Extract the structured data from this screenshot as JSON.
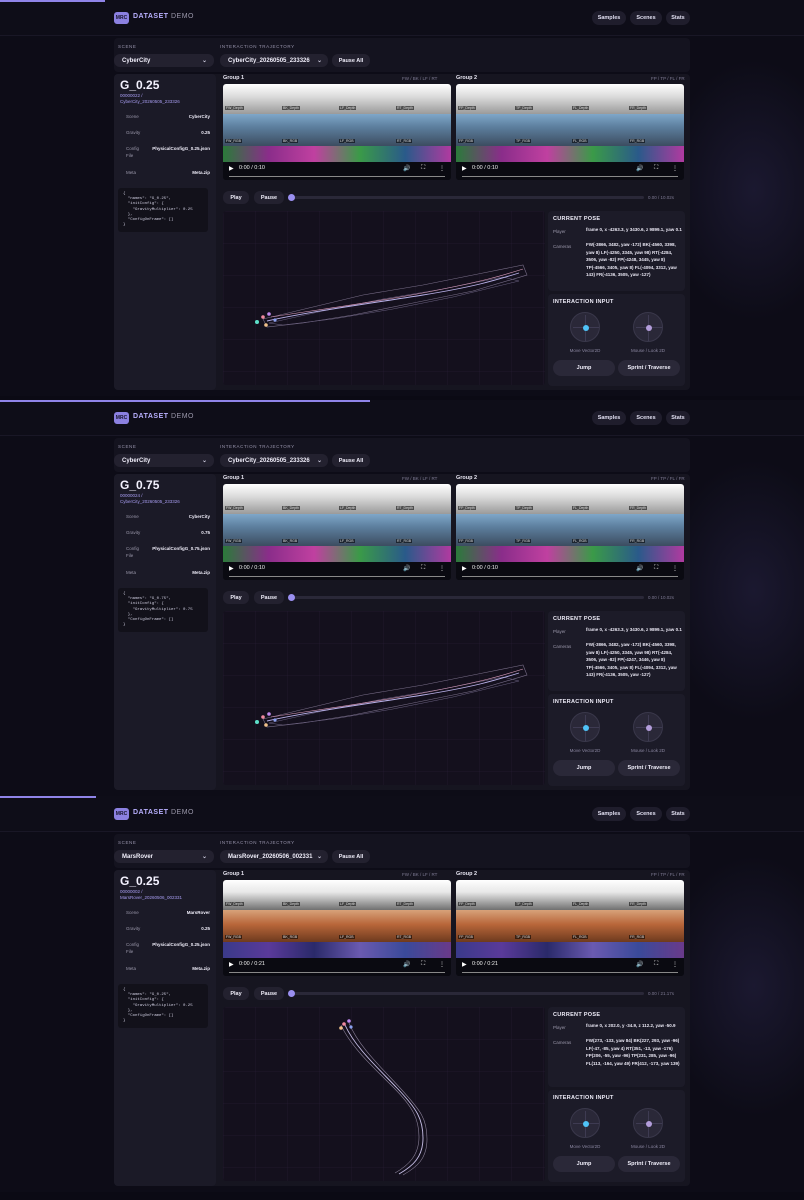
{
  "app": {
    "logo": "MRC",
    "brand_bold": "DATASET",
    "brand_light": "DEMO",
    "nav": [
      "Samples",
      "Scenes",
      "Stats"
    ]
  },
  "labels": {
    "scene": "SCENE",
    "trajectory": "INTERACTION TRAJECTORY",
    "pause_all": "Pause All",
    "play": "Play",
    "pause": "Pause",
    "group1": "Group 1",
    "group2": "Group 2",
    "group1_views": "FW / BK / LF / RT",
    "group2_views": "FP / TP / FL / FR",
    "current_pose": "CURRENT POSE",
    "player": "Player",
    "cameras": "Cameras",
    "interaction_input": "INTERACTION INPUT",
    "move": "Move Vector2D",
    "mouse": "Mouse / Look 2D",
    "jump": "Jump",
    "sprint": "Sprint / Traverse",
    "info_keys": [
      "Scene",
      "Gravity",
      "Config",
      "File",
      "Meta"
    ]
  },
  "icons": {
    "chevron": "chevron-down-icon",
    "play": "play-icon",
    "volume": "volume-icon",
    "fullscreen": "fullscreen-icon",
    "more": "more-icon"
  },
  "colors": {
    "accent": "#8b80e0",
    "move_dot": "#4fc3f7",
    "look_dot": "#b39ddb"
  },
  "group1_tags": [
    "FW_Depth",
    "BK_Depth",
    "LF_Depth",
    "RT_Depth",
    "FW_RGB",
    "BK_RGB",
    "LF_RGB",
    "RT_RGB"
  ],
  "group2_tags": [
    "FP_Depth",
    "TP_Depth",
    "FL_Depth",
    "FR_Depth",
    "FP_RGB",
    "TP_RGB",
    "FL_RGB",
    "FR_RGB"
  ],
  "panels": [
    {
      "progress": 0.13,
      "scene": "CyberCity",
      "trajectory": "CyberCity_20260505_233326",
      "title": "G_0.25",
      "sample_id": "00000022 /",
      "sample_path": "CyberCity_20260505_233326",
      "info_scene": "CyberCity",
      "info_gravity": "0.25",
      "info_config": "PhysicalConfigG_0.25.json",
      "info_meta": "Meta.zip",
      "json": "{\n  \"names\": \"G_0.25\",\n  \"initConfig\": {\n    \"GravityMultiplier\": 0.25\n  },\n  \"ConfigOnFrame\": []\n}",
      "video1_time": "0:00 / 0:10",
      "video2_time": "0:00 / 0:10",
      "total_time": "0.00 / 10.02s",
      "pose_player": "frame 0, x -4263.3, y 3430.6, z 9899.1, yaw 0.1",
      "pose_cameras": "FW(-3866, 3482, yaw -172) BK(-4560, 3398, yaw 8) LF(-4250, 3345, yaw 98) RT(-4284, 3506, yaw -82) FP(-4248, 3445, yaw 8) TP(-4566, 3405, yaw 8) FL(-4094, 3312, yaw 143) FR(-4136, 3505, yaw -127)",
      "scheme": "city"
    },
    {
      "progress": 0.46,
      "scene": "CyberCity",
      "trajectory": "CyberCity_20260505_233326",
      "title": "G_0.75",
      "sample_id": "00000024 /",
      "sample_path": "CyberCity_20260505_233326",
      "info_scene": "CyberCity",
      "info_gravity": "0.75",
      "info_config": "PhysicalConfigG_0.75.json",
      "info_meta": "Meta.zip",
      "json": "{\n  \"names\": \"G_0.75\",\n  \"initConfig\": {\n    \"GravityMultiplier\": 0.75\n  },\n  \"ConfigOnFrame\": []\n}",
      "video1_time": "0:00 / 0:10",
      "video2_time": "0:00 / 0:10",
      "total_time": "0.00 / 10.02s",
      "pose_player": "frame 0, x -4263.3, y 3430.6, z 9899.1, yaw 0.1",
      "pose_cameras": "FW(-3866, 3482, yaw -172) BK(-4560, 3398, yaw 8) LF(-4250, 3345, yaw 98) RT(-4284, 3506, yaw -82) FP(-4247, 3446, yaw 8) TP(-4566, 3405, yaw 8) FL(-4094, 3312, yaw 143) FR(-4136, 3505, yaw -127)",
      "scheme": "city"
    },
    {
      "progress": 0.12,
      "scene": "MarsRover",
      "trajectory": "MarsRover_20260506_002331",
      "title": "G_0.25",
      "sample_id": "00000002 /",
      "sample_path": "MarsRover_20260506_002331",
      "info_scene": "MarsRover",
      "info_gravity": "0.25",
      "info_config": "PhysicalConfigG_0.25.json",
      "info_meta": "Meta.zip",
      "json": "{\n  \"names\": \"G_0.25\",\n  \"initConfig\": {\n    \"GravityMultiplier\": 0.25\n  },\n  \"ConfigOnFrame\": []\n}",
      "video1_time": "0:00 / 0:21",
      "video2_time": "0:00 / 0:21",
      "total_time": "0.00 / 21.17s",
      "pose_player": "frame 0, x 202.0, y -34.9, z 112.2, yaw -50.9",
      "pose_cameras": "FW(273, -133, yaw 84) BK(227, 293, yaw -96) LF(-47, -85, yaw 4) RT(351, -13, yaw -176) FP(206, -55, yaw -96) TP(231, 285, yaw -96) FL(113, -164, yaw 49) FR(412, -173, yaw 139)",
      "scheme": "mars"
    }
  ]
}
